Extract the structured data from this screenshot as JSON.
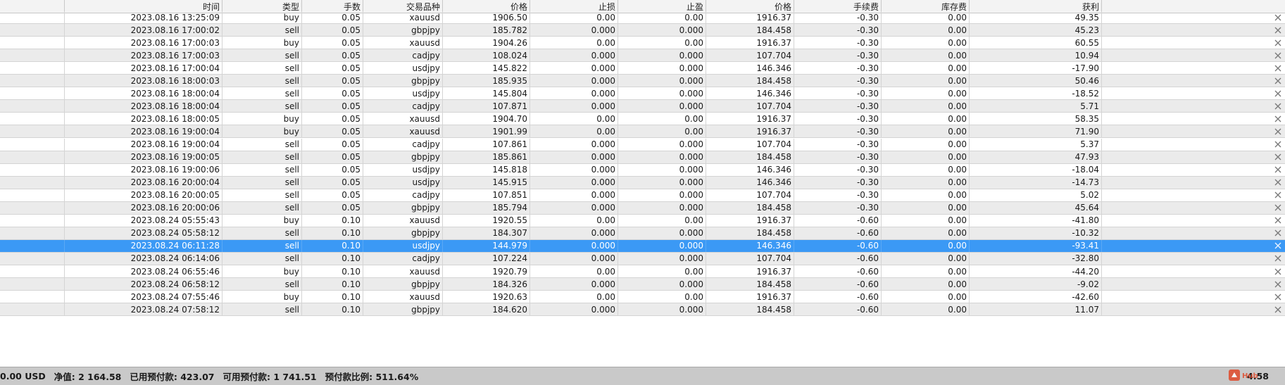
{
  "columns": [
    {
      "key": "time",
      "label": "时间"
    },
    {
      "key": "type",
      "label": "类型"
    },
    {
      "key": "lots",
      "label": "手数"
    },
    {
      "key": "symbol",
      "label": "交易品种"
    },
    {
      "key": "price_open",
      "label": "价格"
    },
    {
      "key": "sl",
      "label": "止损"
    },
    {
      "key": "tp",
      "label": "止盈"
    },
    {
      "key": "price_cur",
      "label": "价格"
    },
    {
      "key": "commission",
      "label": "手续费"
    },
    {
      "key": "swap",
      "label": "库存费"
    },
    {
      "key": "profit",
      "label": "获利"
    }
  ],
  "rows": [
    {
      "time": "2023.08.16 13:25:09",
      "type": "buy",
      "lots": "0.05",
      "symbol": "xauusd",
      "price_open": "1906.50",
      "sl": "0.00",
      "tp": "0.00",
      "price_cur": "1916.37",
      "commission": "-0.30",
      "swap": "0.00",
      "profit": "49.35"
    },
    {
      "time": "2023.08.16 17:00:02",
      "type": "sell",
      "lots": "0.05",
      "symbol": "gbpjpy",
      "price_open": "185.782",
      "sl": "0.000",
      "tp": "0.000",
      "price_cur": "184.458",
      "commission": "-0.30",
      "swap": "0.00",
      "profit": "45.23"
    },
    {
      "time": "2023.08.16 17:00:03",
      "type": "buy",
      "lots": "0.05",
      "symbol": "xauusd",
      "price_open": "1904.26",
      "sl": "0.00",
      "tp": "0.00",
      "price_cur": "1916.37",
      "commission": "-0.30",
      "swap": "0.00",
      "profit": "60.55"
    },
    {
      "time": "2023.08.16 17:00:03",
      "type": "sell",
      "lots": "0.05",
      "symbol": "cadjpy",
      "price_open": "108.024",
      "sl": "0.000",
      "tp": "0.000",
      "price_cur": "107.704",
      "commission": "-0.30",
      "swap": "0.00",
      "profit": "10.94"
    },
    {
      "time": "2023.08.16 17:00:04",
      "type": "sell",
      "lots": "0.05",
      "symbol": "usdjpy",
      "price_open": "145.822",
      "sl": "0.000",
      "tp": "0.000",
      "price_cur": "146.346",
      "commission": "-0.30",
      "swap": "0.00",
      "profit": "-17.90"
    },
    {
      "time": "2023.08.16 18:00:03",
      "type": "sell",
      "lots": "0.05",
      "symbol": "gbpjpy",
      "price_open": "185.935",
      "sl": "0.000",
      "tp": "0.000",
      "price_cur": "184.458",
      "commission": "-0.30",
      "swap": "0.00",
      "profit": "50.46"
    },
    {
      "time": "2023.08.16 18:00:04",
      "type": "sell",
      "lots": "0.05",
      "symbol": "usdjpy",
      "price_open": "145.804",
      "sl": "0.000",
      "tp": "0.000",
      "price_cur": "146.346",
      "commission": "-0.30",
      "swap": "0.00",
      "profit": "-18.52"
    },
    {
      "time": "2023.08.16 18:00:04",
      "type": "sell",
      "lots": "0.05",
      "symbol": "cadjpy",
      "price_open": "107.871",
      "sl": "0.000",
      "tp": "0.000",
      "price_cur": "107.704",
      "commission": "-0.30",
      "swap": "0.00",
      "profit": "5.71"
    },
    {
      "time": "2023.08.16 18:00:05",
      "type": "buy",
      "lots": "0.05",
      "symbol": "xauusd",
      "price_open": "1904.70",
      "sl": "0.00",
      "tp": "0.00",
      "price_cur": "1916.37",
      "commission": "-0.30",
      "swap": "0.00",
      "profit": "58.35"
    },
    {
      "time": "2023.08.16 19:00:04",
      "type": "buy",
      "lots": "0.05",
      "symbol": "xauusd",
      "price_open": "1901.99",
      "sl": "0.00",
      "tp": "0.00",
      "price_cur": "1916.37",
      "commission": "-0.30",
      "swap": "0.00",
      "profit": "71.90"
    },
    {
      "time": "2023.08.16 19:00:04",
      "type": "sell",
      "lots": "0.05",
      "symbol": "cadjpy",
      "price_open": "107.861",
      "sl": "0.000",
      "tp": "0.000",
      "price_cur": "107.704",
      "commission": "-0.30",
      "swap": "0.00",
      "profit": "5.37"
    },
    {
      "time": "2023.08.16 19:00:05",
      "type": "sell",
      "lots": "0.05",
      "symbol": "gbpjpy",
      "price_open": "185.861",
      "sl": "0.000",
      "tp": "0.000",
      "price_cur": "184.458",
      "commission": "-0.30",
      "swap": "0.00",
      "profit": "47.93"
    },
    {
      "time": "2023.08.16 19:00:06",
      "type": "sell",
      "lots": "0.05",
      "symbol": "usdjpy",
      "price_open": "145.818",
      "sl": "0.000",
      "tp": "0.000",
      "price_cur": "146.346",
      "commission": "-0.30",
      "swap": "0.00",
      "profit": "-18.04"
    },
    {
      "time": "2023.08.16 20:00:04",
      "type": "sell",
      "lots": "0.05",
      "symbol": "usdjpy",
      "price_open": "145.915",
      "sl": "0.000",
      "tp": "0.000",
      "price_cur": "146.346",
      "commission": "-0.30",
      "swap": "0.00",
      "profit": "-14.73"
    },
    {
      "time": "2023.08.16 20:00:05",
      "type": "sell",
      "lots": "0.05",
      "symbol": "cadjpy",
      "price_open": "107.851",
      "sl": "0.000",
      "tp": "0.000",
      "price_cur": "107.704",
      "commission": "-0.30",
      "swap": "0.00",
      "profit": "5.02"
    },
    {
      "time": "2023.08.16 20:00:06",
      "type": "sell",
      "lots": "0.05",
      "symbol": "gbpjpy",
      "price_open": "185.794",
      "sl": "0.000",
      "tp": "0.000",
      "price_cur": "184.458",
      "commission": "-0.30",
      "swap": "0.00",
      "profit": "45.64"
    },
    {
      "time": "2023.08.24 05:55:43",
      "type": "buy",
      "lots": "0.10",
      "symbol": "xauusd",
      "price_open": "1920.55",
      "sl": "0.00",
      "tp": "0.00",
      "price_cur": "1916.37",
      "commission": "-0.60",
      "swap": "0.00",
      "profit": "-41.80"
    },
    {
      "time": "2023.08.24 05:58:12",
      "type": "sell",
      "lots": "0.10",
      "symbol": "gbpjpy",
      "price_open": "184.307",
      "sl": "0.000",
      "tp": "0.000",
      "price_cur": "184.458",
      "commission": "-0.60",
      "swap": "0.00",
      "profit": "-10.32"
    },
    {
      "time": "2023.08.24 06:11:28",
      "type": "sell",
      "lots": "0.10",
      "symbol": "usdjpy",
      "price_open": "144.979",
      "sl": "0.000",
      "tp": "0.000",
      "price_cur": "146.346",
      "commission": "-0.60",
      "swap": "0.00",
      "profit": "-93.41",
      "selected": true
    },
    {
      "time": "2023.08.24 06:14:06",
      "type": "sell",
      "lots": "0.10",
      "symbol": "cadjpy",
      "price_open": "107.224",
      "sl": "0.000",
      "tp": "0.000",
      "price_cur": "107.704",
      "commission": "-0.60",
      "swap": "0.00",
      "profit": "-32.80"
    },
    {
      "time": "2023.08.24 06:55:46",
      "type": "buy",
      "lots": "0.10",
      "symbol": "xauusd",
      "price_open": "1920.79",
      "sl": "0.00",
      "tp": "0.00",
      "price_cur": "1916.37",
      "commission": "-0.60",
      "swap": "0.00",
      "profit": "-44.20"
    },
    {
      "time": "2023.08.24 06:58:12",
      "type": "sell",
      "lots": "0.10",
      "symbol": "gbpjpy",
      "price_open": "184.326",
      "sl": "0.000",
      "tp": "0.000",
      "price_cur": "184.458",
      "commission": "-0.60",
      "swap": "0.00",
      "profit": "-9.02"
    },
    {
      "time": "2023.08.24 07:55:46",
      "type": "buy",
      "lots": "0.10",
      "symbol": "xauusd",
      "price_open": "1920.63",
      "sl": "0.00",
      "tp": "0.00",
      "price_cur": "1916.37",
      "commission": "-0.60",
      "swap": "0.00",
      "profit": "-42.60"
    },
    {
      "time": "2023.08.24 07:58:12",
      "type": "sell",
      "lots": "0.10",
      "symbol": "gbpjpy",
      "price_open": "184.620",
      "sl": "0.000",
      "tp": "0.000",
      "price_cur": "184.458",
      "commission": "-0.60",
      "swap": "0.00",
      "profit": "11.07"
    }
  ],
  "status_bar": {
    "balance": "0.00 USD",
    "equity": "净值: 2 164.58",
    "margin": "已用预付款: 423.07",
    "free_margin": "可用预付款: 1 741.51",
    "margin_level": "预付款比例: 511.64%",
    "total_profit": "4.58"
  },
  "watermark": {
    "text": "Hub"
  },
  "colors": {
    "selected_row": "#3b99f5",
    "alt_row": "#ebebeb",
    "status_bar": "#c9c9c9"
  },
  "icons": {
    "row_close": "close-icon",
    "watermark": "logo-icon"
  }
}
